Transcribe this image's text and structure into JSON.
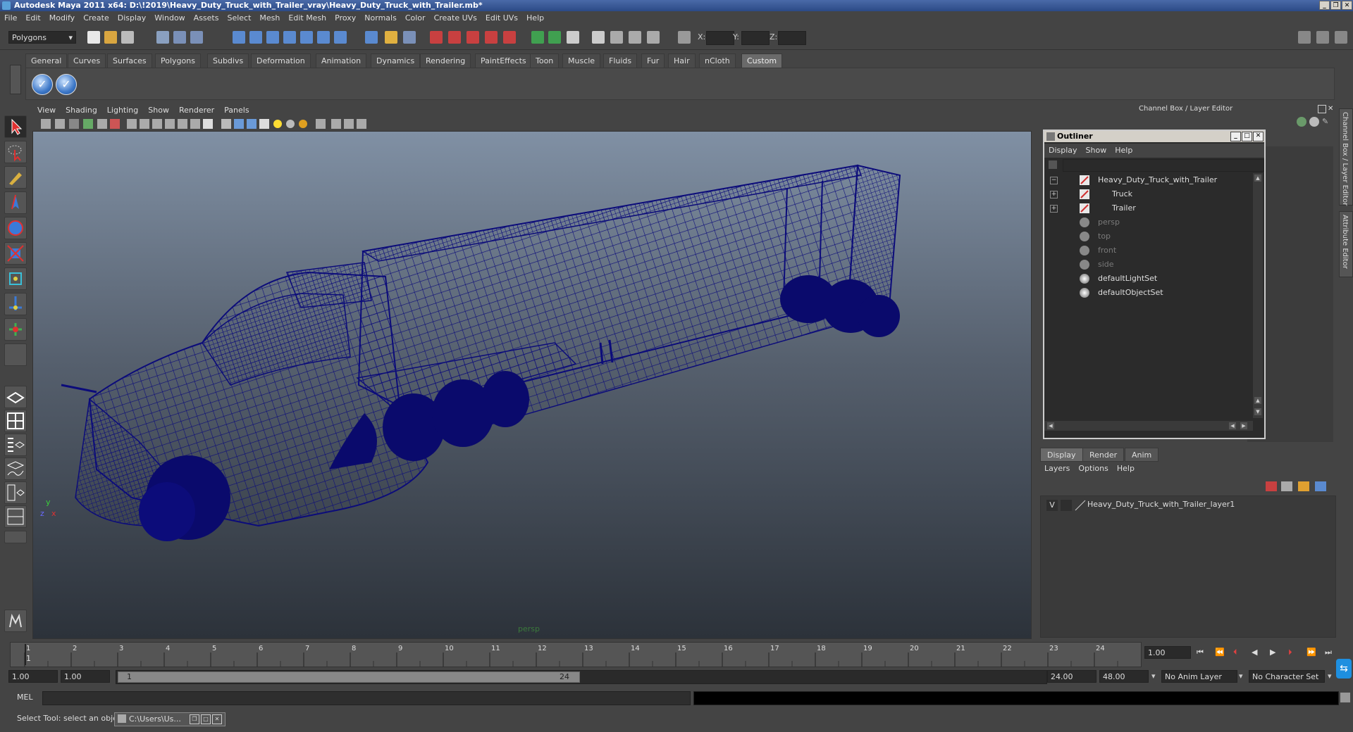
{
  "window": {
    "title": "Autodesk Maya 2011 x64: D:\\!2019\\Heavy_Duty_Truck_with_Trailer_vray\\Heavy_Duty_Truck_with_Trailer.mb*",
    "minimize": "_",
    "restore": "❐",
    "close": "✕"
  },
  "menubar": [
    "File",
    "Edit",
    "Modify",
    "Create",
    "Display",
    "Window",
    "Assets",
    "Select",
    "Mesh",
    "Edit Mesh",
    "Proxy",
    "Normals",
    "Color",
    "Create UVs",
    "Edit UVs",
    "Help"
  ],
  "toolbar": {
    "mode": "Polygons",
    "x_label": "X:",
    "y_label": "Y:",
    "z_label": "Z:"
  },
  "shelf_tabs": [
    "General",
    "Curves",
    "Surfaces",
    "Polygons",
    "Subdivs",
    "Deformation",
    "Animation",
    "Dynamics",
    "Rendering",
    "PaintEffects",
    "Toon",
    "Muscle",
    "Fluids",
    "Fur",
    "Hair",
    "nCloth",
    "Custom"
  ],
  "shelf_active_tab": "Custom",
  "viewport": {
    "menu": [
      "View",
      "Shading",
      "Lighting",
      "Show",
      "Renderer",
      "Panels"
    ],
    "camera": "persp",
    "axis_y": "y",
    "axis_x": "x",
    "axis_z": "z",
    "wire_color": "#0c0c7a"
  },
  "channel_box": {
    "title": "Channel Box / Layer Editor",
    "side_tab_1": "Channel Box / Layer Editor",
    "side_tab_2": "Attribute Editor"
  },
  "outliner": {
    "title": "Outliner",
    "menu": [
      "Display",
      "Show",
      "Help"
    ],
    "items": [
      {
        "label": "Heavy_Duty_Truck_with_Trailer",
        "expander": "−",
        "dim": false
      },
      {
        "label": "Truck",
        "expander": "+",
        "dim": false
      },
      {
        "label": "Trailer",
        "expander": "+",
        "dim": false
      },
      {
        "label": "persp",
        "expander": "",
        "dim": true
      },
      {
        "label": "top",
        "expander": "",
        "dim": true
      },
      {
        "label": "front",
        "expander": "",
        "dim": true
      },
      {
        "label": "side",
        "expander": "",
        "dim": true
      },
      {
        "label": "defaultLightSet",
        "expander": "",
        "dim": false
      },
      {
        "label": "defaultObjectSet",
        "expander": "",
        "dim": false
      }
    ]
  },
  "layer_editor": {
    "tabs": [
      "Display",
      "Render",
      "Anim"
    ],
    "menu": [
      "Layers",
      "Options",
      "Help"
    ],
    "layer_visible": "V",
    "layer_name": "Heavy_Duty_Truck_with_Trailer_layer1"
  },
  "timeline": {
    "ticks": [
      "1",
      "2",
      "3",
      "4",
      "5",
      "6",
      "7",
      "8",
      "9",
      "10",
      "11",
      "12",
      "13",
      "14",
      "15",
      "16",
      "17",
      "18",
      "19",
      "20",
      "21",
      "22",
      "23",
      "24"
    ],
    "current_frame": "1",
    "current_time_field": "1.00"
  },
  "range": {
    "start": "1.00",
    "playback_start": "1.00",
    "slider_start": "1",
    "slider_end": "24",
    "playback_end": "24.00",
    "end": "48.00",
    "anim_layer": "No Anim Layer",
    "char_set": "No Character Set"
  },
  "command_line": {
    "label": "MEL"
  },
  "status": {
    "help": "Select Tool: select an object",
    "task": "C:\\Users\\Us..."
  }
}
